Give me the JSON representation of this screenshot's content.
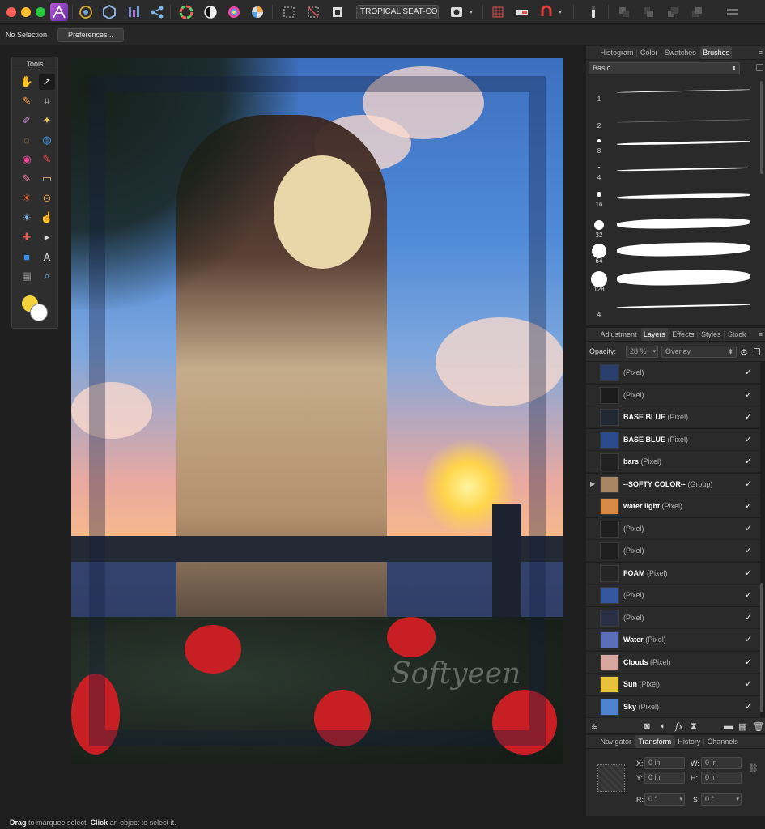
{
  "toolbar": {
    "document_field": "TROPICAL SEAT-COLOR",
    "icons": [
      "affinity-logo-icon",
      "persona-photo-icon",
      "persona-liquify-icon",
      "persona-develop-icon",
      "persona-export-icon",
      "color-wheel-icon",
      "bw-adjust-icon",
      "hsl-icon",
      "white-balance-icon",
      "marquee-icon",
      "deselect-icon",
      "invert-selection-icon",
      "quick-mask-icon",
      "refine-icon",
      "snapping-icon",
      "assistant-icon",
      "insert-target-icon",
      "arrange-icon",
      "more-icon"
    ]
  },
  "context": {
    "selection_label": "No Selection",
    "preferences_label": "Preferences..."
  },
  "tools": {
    "title": "Tools",
    "items": [
      "view-hand-icon",
      "move-arrow-icon",
      "color-picker-icon",
      "crop-icon",
      "paint-brush-icon",
      "selection-brush-icon",
      "freehand-select-icon",
      "flood-fill-icon",
      "color-replace-icon",
      "pixel-brush-icon",
      "erase-brush-icon",
      "eraser-icon",
      "burn-icon",
      "clone-icon",
      "dodge-icon",
      "smudge-icon",
      "healing-icon",
      "node-icon",
      "rectangle-icon",
      "text-icon",
      "mesh-icon",
      "zoom-icon"
    ],
    "colors": {
      "foreground": "#f4d23c",
      "background": "#ffffff"
    }
  },
  "artwork": {
    "watermark": "Softyeen"
  },
  "brushes_panel": {
    "tabs": [
      "Histogram",
      "Color",
      "Swatches",
      "Brushes"
    ],
    "active_tab": "Brushes",
    "category": "Basic",
    "sizes": [
      "1",
      "2",
      "8",
      "4",
      "16",
      "32",
      "64",
      "128",
      "4"
    ]
  },
  "layers_panel": {
    "tabs": [
      "Adjustment",
      "Layers",
      "Effects",
      "Styles",
      "Stock"
    ],
    "active_tab": "Layers",
    "opacity_label": "Opacity:",
    "opacity_value": "28 %",
    "blend_mode": "Overlay",
    "layers": [
      {
        "name": "",
        "kind": "(Pixel)",
        "thumb": "#2a3f6e",
        "visible": true
      },
      {
        "name": "",
        "kind": "(Pixel)",
        "thumb": "#1b1b1b",
        "visible": true
      },
      {
        "name": "BASE BLUE",
        "kind": "(Pixel)",
        "thumb": "#222831",
        "visible": true
      },
      {
        "name": "BASE BLUE",
        "kind": "(Pixel)",
        "thumb": "#2a4a8a",
        "visible": true
      },
      {
        "name": "bars",
        "kind": "(Pixel)",
        "thumb": "#222222",
        "visible": true
      },
      {
        "name": "--SOFTY COLOR--",
        "kind": "(Group)",
        "thumb": "#a88565",
        "visible": true
      },
      {
        "name": "water light",
        "kind": "(Pixel)",
        "thumb": "#d78a46",
        "visible": true
      },
      {
        "name": "",
        "kind": "(Pixel)",
        "thumb": "#1e1e1e",
        "visible": true
      },
      {
        "name": "",
        "kind": "(Pixel)",
        "thumb": "#1e1e1e",
        "visible": true
      },
      {
        "name": "FOAM",
        "kind": "(Pixel)",
        "thumb": "#252525",
        "visible": true
      },
      {
        "name": "",
        "kind": "(Pixel)",
        "thumb": "#3557a0",
        "visible": true
      },
      {
        "name": "",
        "kind": "(Pixel)",
        "thumb": "#2b2f45",
        "visible": true
      },
      {
        "name": "Water",
        "kind": "(Pixel)",
        "thumb": "#5a6fb8",
        "visible": true
      },
      {
        "name": "Clouds",
        "kind": "(Pixel)",
        "thumb": "#d8a7a0",
        "visible": true
      },
      {
        "name": "Sun",
        "kind": "(Pixel)",
        "thumb": "#e8c23a",
        "visible": true
      },
      {
        "name": "Sky",
        "kind": "(Pixel)",
        "thumb": "#4f82cf",
        "visible": true
      }
    ]
  },
  "transform_panel": {
    "tabs": [
      "Navigator",
      "Transform",
      "History",
      "Channels"
    ],
    "active_tab": "Transform",
    "x_label": "X:",
    "x_value": "0 in",
    "y_label": "Y:",
    "y_value": "0 in",
    "w_label": "W:",
    "w_value": "0 in",
    "h_label": "H:",
    "h_value": "0 in",
    "r_label": "R:",
    "r_value": "0 °",
    "s_label": "S:",
    "s_value": "0 °"
  },
  "status": {
    "drag_word": "Drag",
    "drag_text": " to marquee select. ",
    "click_word": "Click",
    "click_text": " an object to select it."
  }
}
